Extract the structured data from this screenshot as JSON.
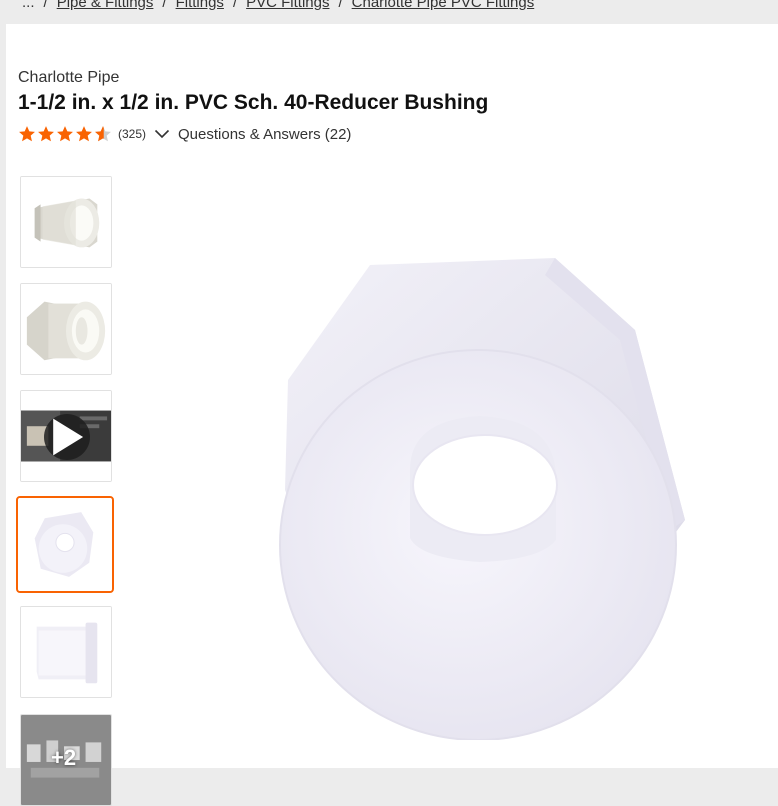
{
  "breadcrumb": {
    "ellipsis": "...",
    "items": [
      "Pipe & Fittings",
      "Fittings",
      "PVC Fittings",
      "Charlotte Pipe PVC Fittings"
    ],
    "separator": "/"
  },
  "product": {
    "brand": "Charlotte Pipe",
    "title": "1-1/2 in. x 1/2 in. PVC Sch. 40-Reducer Bushing",
    "rating": 4.5,
    "rating_max": 5,
    "review_count": "(325)",
    "qa_label": "Questions & Answers (22)"
  },
  "thumbnails": [
    {
      "kind": "image",
      "icon": "bushing-side-thumbnail"
    },
    {
      "kind": "image",
      "icon": "bushing-angle-thumbnail"
    },
    {
      "kind": "video",
      "icon": "play-icon"
    },
    {
      "kind": "image",
      "icon": "bushing-front-thumbnail",
      "selected": true
    },
    {
      "kind": "image",
      "icon": "bushing-profile-thumbnail"
    },
    {
      "kind": "more",
      "label": "+2"
    }
  ],
  "colors": {
    "accent": "#f96302",
    "star": "#f96302",
    "text": "#333333"
  }
}
